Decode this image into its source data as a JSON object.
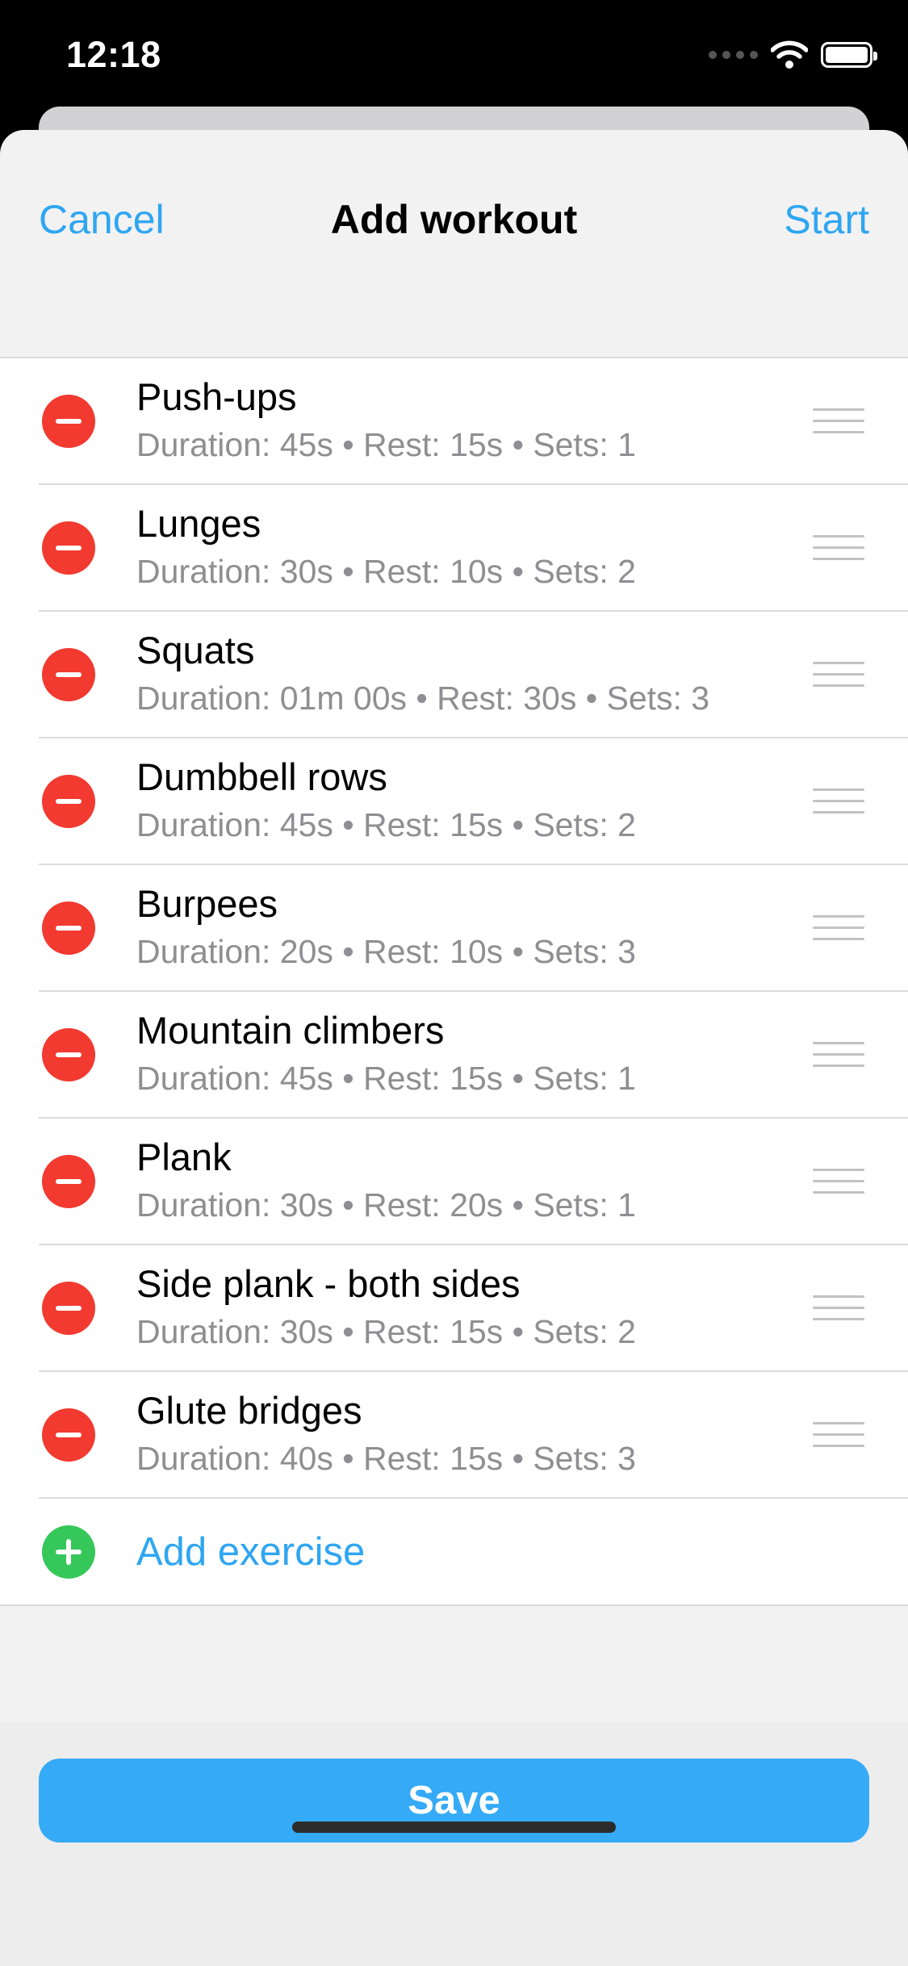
{
  "status_bar": {
    "time": "12:18",
    "icons": [
      "signal-dots-icon",
      "wifi-icon",
      "battery-icon"
    ]
  },
  "nav": {
    "cancel_label": "Cancel",
    "title": "Add workout",
    "start_label": "Start"
  },
  "exercises": [
    {
      "name": "Push-ups",
      "detail": "Duration: 45s • Rest: 15s • Sets: 1"
    },
    {
      "name": "Lunges",
      "detail": "Duration: 30s • Rest: 10s • Sets: 2"
    },
    {
      "name": "Squats",
      "detail": "Duration: 01m 00s • Rest: 30s • Sets: 3"
    },
    {
      "name": "Dumbbell rows",
      "detail": "Duration: 45s • Rest: 15s • Sets: 2"
    },
    {
      "name": "Burpees",
      "detail": "Duration: 20s • Rest: 10s • Sets: 3"
    },
    {
      "name": "Mountain climbers",
      "detail": "Duration: 45s • Rest: 15s • Sets: 1"
    },
    {
      "name": "Plank",
      "detail": "Duration: 30s • Rest: 20s • Sets: 1"
    },
    {
      "name": "Side plank - both sides",
      "detail": "Duration: 30s • Rest: 15s • Sets: 2"
    },
    {
      "name": "Glute bridges",
      "detail": "Duration: 40s • Rest: 15s • Sets: 3"
    }
  ],
  "add_exercise_label": "Add exercise",
  "save_label": "Save",
  "colors": {
    "accent": "#2fa6f1",
    "save_button": "#35aaf6",
    "remove": "#f23a30",
    "add": "#35c759",
    "secondary_text": "#8e8e93"
  }
}
